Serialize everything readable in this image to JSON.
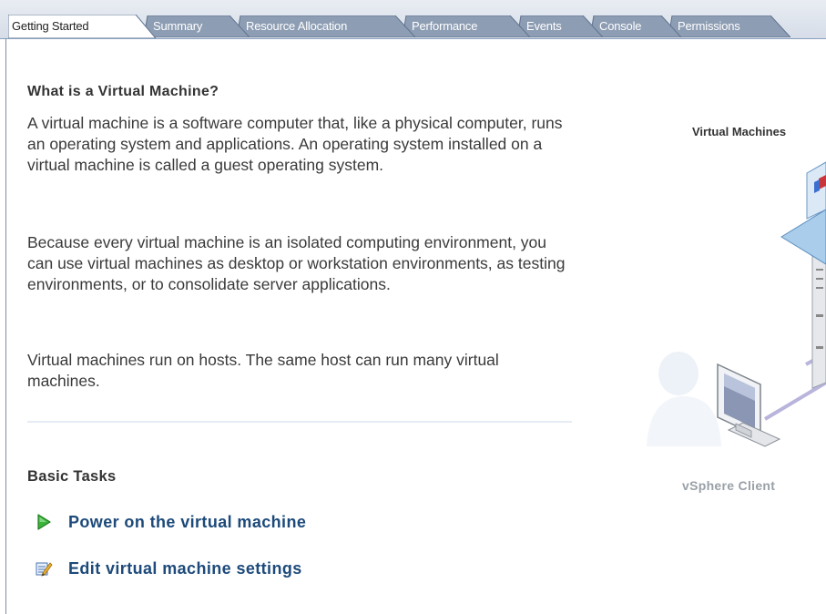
{
  "tabs": [
    {
      "label": "Getting Started",
      "active": true
    },
    {
      "label": "Summary",
      "active": false
    },
    {
      "label": "Resource Allocation",
      "active": false
    },
    {
      "label": "Performance",
      "active": false
    },
    {
      "label": "Events",
      "active": false
    },
    {
      "label": "Console",
      "active": false
    },
    {
      "label": "Permissions",
      "active": false
    }
  ],
  "main": {
    "heading": "What is a Virtual Machine?",
    "paragraphs": [
      "A virtual machine is a software computer that, like a physical computer, runs an operating system and applications. An operating system installed on a virtual machine is called a guest operating system.",
      "Because every virtual machine is an isolated computing environment, you can use virtual machines as desktop or workstation environments, as testing environments, or to consolidate server applications.",
      "Virtual machines run on hosts. The same host can run many virtual machines."
    ],
    "basic_tasks": {
      "heading": "Basic Tasks",
      "items": [
        {
          "label": "Power on the virtual machine",
          "icon": "power-on-icon"
        },
        {
          "label": "Edit virtual machine settings",
          "icon": "edit-settings-icon"
        }
      ]
    }
  },
  "diagram": {
    "label_top": "Virtual Machines",
    "label_bottom": "vSphere Client"
  },
  "colors": {
    "tab_inactive": "#8d9db3",
    "tab_active": "#ffffff",
    "link": "#1d4a7a",
    "play_green": "#3cb43c"
  }
}
